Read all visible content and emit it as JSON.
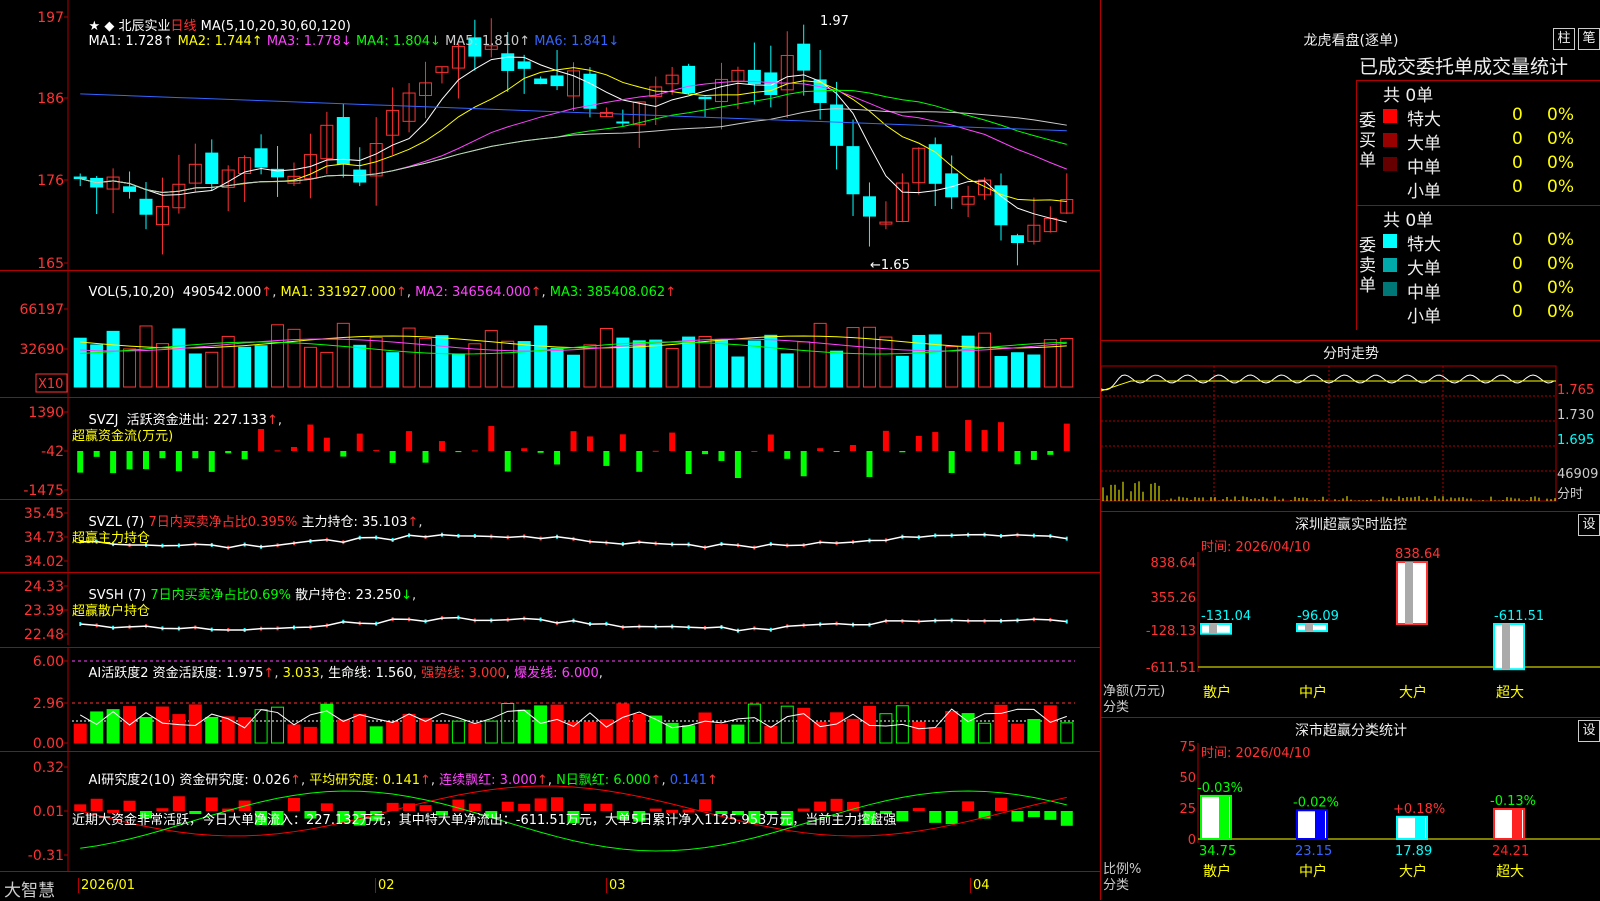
{
  "main": {
    "stock_name": "北辰实业",
    "period": "日线",
    "ma_label": "MA(5,10,20,30,60,120)",
    "ma": [
      {
        "name": "MA1:",
        "value": "1.728",
        "arrow": "↑",
        "color": "#ffffff"
      },
      {
        "name": "MA2:",
        "value": "1.744",
        "arrow": "↑",
        "color": "#ffff00"
      },
      {
        "name": "MA3:",
        "value": "1.778",
        "arrow": "↓",
        "color": "#ff44ff"
      },
      {
        "name": "MA4:",
        "value": "1.804",
        "arrow": "↓",
        "color": "#00ff00"
      },
      {
        "name": "MA5:",
        "value": "1.810",
        "arrow": "↑",
        "color": "#cccccc"
      },
      {
        "name": "MA6:",
        "value": "1.841",
        "arrow": "↓",
        "color": "#3366ff"
      }
    ],
    "y_ticks": [
      "197",
      "186",
      "176",
      "165"
    ],
    "high_label": "1.97",
    "low_label": "←1.65",
    "x_ticks": [
      "2026/01",
      "02",
      "03",
      "04"
    ]
  },
  "vol": {
    "label": "VOL(5,10,20)",
    "value": "490542.000",
    "ma1": "MA1: 331927.000",
    "ma2": "MA2: 346564.000",
    "ma3": "MA3: 385408.062",
    "y_ticks": [
      "66197",
      "32690"
    ],
    "unit": "X10"
  },
  "svzj": {
    "label": "SVZJ  活跃资金进出: 227.133",
    "sub": "超赢资金流(万元)",
    "y_ticks": [
      "1390",
      "-42",
      "-1475"
    ]
  },
  "svzl": {
    "label": "SVZL (7)",
    "ratio": "7日内买卖净占比0.395%",
    "hold": "主力持仓: 35.103",
    "sub": "超赢主力持仓",
    "y_ticks": [
      "35.45",
      "34.73",
      "34.02"
    ]
  },
  "svsh": {
    "label": "SVSH (7)",
    "ratio": "7日内买卖净占比0.69%",
    "hold": "散户持仓: 23.250",
    "sub": "超赢散户持仓",
    "y_ticks": [
      "24.33",
      "23.39",
      "22.48"
    ]
  },
  "ai1": {
    "label": "AI活跃度2",
    "a": "资金活跃度: 1.975",
    "b": "3.033",
    "c": "生命线: 1.560",
    "d": "强势线: 3.000",
    "e": "爆发线: 6.000",
    "y_ticks": [
      "6.00",
      "2.96",
      "0.00"
    ]
  },
  "ai2": {
    "label": "AI研究度2(10)",
    "a": "资金研究度: 0.026",
    "b": "平均研究度: 0.141",
    "c": "连续飘红: 3.000",
    "d": "N日飘红: 6.000",
    "e": "0.141",
    "comment": "近期大资金非常活跃，今日大单净流入：227.132万元，其中特大单净流出：-611.51万元，大单5日累计净入1125.953万元，当前主力控盘强",
    "y_ticks": [
      "0.32",
      "0.01",
      "-0.31"
    ]
  },
  "footer": {
    "brand": "大智慧"
  },
  "longhu": {
    "title": "龙虎看盘(逐单)",
    "btn_bar": "柱",
    "btn_pen": "笔",
    "table_title": "已成交委托单成交量统计",
    "buy": {
      "side_label": "委买单",
      "count": "共 0单",
      "rows": [
        {
          "label": "特大",
          "color": "#ff0000",
          "val": "0",
          "pct": "0%"
        },
        {
          "label": "大单",
          "color": "#990000",
          "val": "0",
          "pct": "0%"
        },
        {
          "label": "中单",
          "color": "#660000",
          "val": "0",
          "pct": "0%"
        },
        {
          "label": "小单",
          "color": "#000000",
          "val": "0",
          "pct": "0%"
        }
      ]
    },
    "sell": {
      "side_label": "委卖单",
      "count": "共 0单",
      "rows": [
        {
          "label": "特大",
          "color": "#00ffff",
          "val": "0",
          "pct": "0%"
        },
        {
          "label": "大单",
          "color": "#00aaaa",
          "val": "0",
          "pct": "0%"
        },
        {
          "label": "中单",
          "color": "#007777",
          "val": "0",
          "pct": "0%"
        },
        {
          "label": "小单",
          "color": "#000000",
          "val": "0",
          "pct": "0%"
        }
      ]
    }
  },
  "intraday": {
    "title": "分时走势",
    "y_ticks": [
      "1.765",
      "1.730",
      "1.695"
    ],
    "vol_tick": "46909",
    "unit_label": "分时"
  },
  "monitor": {
    "title": "深圳超赢实时监控",
    "btn": "设",
    "time": "时间: 2026/04/10",
    "y_ticks": [
      "838.64",
      "355.26",
      "-128.13",
      "-611.51"
    ],
    "y_unit": "净额(万元)",
    "x_unit": "分类",
    "categories": [
      "散户",
      "中户",
      "大户",
      "超大"
    ],
    "values": [
      -131.04,
      -96.09,
      838.64,
      -611.51
    ],
    "value_labels": [
      "-131.04",
      "-96.09",
      "838.64",
      "-611.51"
    ]
  },
  "classify": {
    "title": "深市超赢分类统计",
    "btn": "设",
    "time": "时间: 2026/04/10",
    "y_ticks": [
      "75",
      "50",
      "25",
      "0"
    ],
    "y_unit": "比例%",
    "x_unit": "分类",
    "categories": [
      "散户",
      "中户",
      "大户",
      "超大"
    ],
    "values": [
      34.75,
      23.15,
      17.89,
      24.21
    ],
    "value_labels": [
      "34.75",
      "23.15",
      "17.89",
      "24.21"
    ],
    "delta_labels": [
      "-0.03%",
      "-0.02%",
      "+0.18%",
      "-0.13%"
    ],
    "bar_colors": [
      "#00ff00",
      "#0000ff",
      "#00ffff",
      "#ff2222"
    ]
  },
  "chart_data": [
    {
      "type": "bar",
      "title": "深圳超赢实时监控",
      "categories": [
        "散户",
        "中户",
        "大户",
        "超大"
      ],
      "values": [
        -131.04,
        -96.09,
        838.64,
        -611.51
      ],
      "ylabel": "净额(万元)",
      "xlabel": "分类",
      "ylim": [
        -611.51,
        838.64
      ]
    },
    {
      "type": "bar",
      "title": "深市超赢分类统计",
      "categories": [
        "散户",
        "中户",
        "大户",
        "超大"
      ],
      "values": [
        34.75,
        23.15,
        17.89,
        24.21
      ],
      "ylabel": "比例%",
      "xlabel": "分类",
      "ylim": [
        0,
        75
      ]
    }
  ]
}
